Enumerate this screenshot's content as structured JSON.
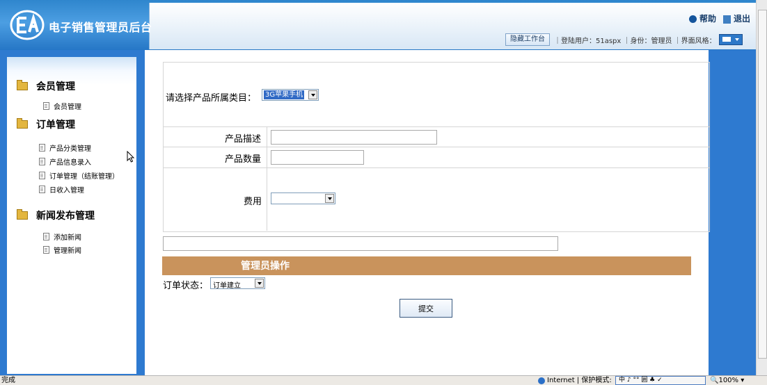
{
  "header": {
    "logo_glyph": "EA",
    "title": "电子销售管理员后台",
    "help_label": "帮助",
    "logout_label": "退出",
    "hide_workbench_label": "隐藏工作台",
    "user_text": "｜登陆用户：51aspx ｜身份：管理员 ｜界面风格："
  },
  "sidebar": {
    "sections": [
      {
        "title": "会员管理",
        "items": [
          "会员管理"
        ]
      },
      {
        "title": "订单管理",
        "items": [
          "产品分类管理",
          "产品信息录入",
          "订单管理（结账管理）",
          "日收入管理"
        ]
      },
      {
        "title": "新闻发布管理",
        "items": [
          "添加新闻",
          "管理新闻"
        ]
      }
    ]
  },
  "form": {
    "category_label": "请选择产品所属类目：",
    "category_value": "3G苹果手机",
    "description_label": "产品描述",
    "quantity_label": "产品数量",
    "cost_label": "费用"
  },
  "admin_ops": {
    "title": "管理员操作",
    "order_status_label": "订单状态：",
    "order_status_value": "订单建立",
    "submit_label": "提交"
  },
  "statusbar": {
    "left_text": "完成",
    "zone_text": "Internet | 保护模式:",
    "ime_text": "中 ♪ °° 囲 ♣ ✓",
    "zoom_text": "100%"
  }
}
